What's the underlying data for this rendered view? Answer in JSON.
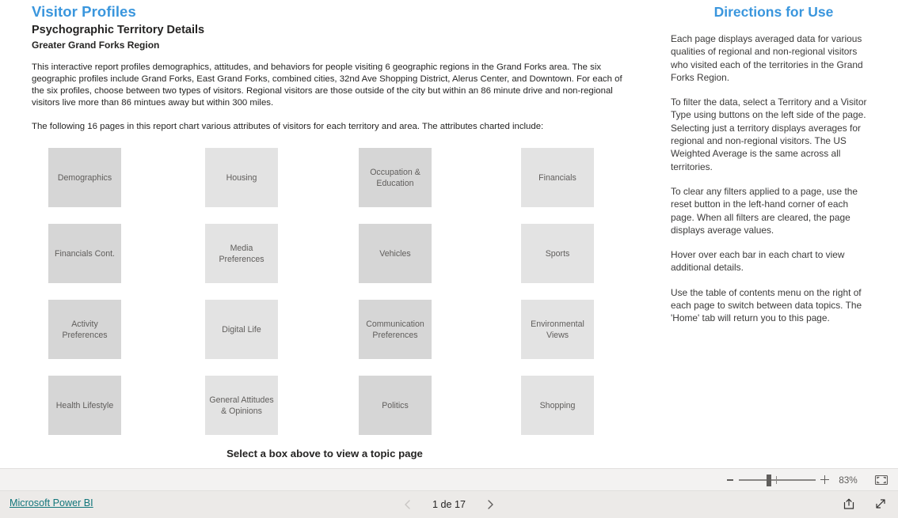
{
  "report": {
    "title": "Visitor Profiles",
    "subtitle": "Psychographic Territory Details",
    "region": "Greater Grand Forks Region",
    "intro_paragraph_1": "This interactive report profiles demographics, attitudes, and behaviors for people visiting 6 geographic regions in the Grand Forks area. The six geographic profiles include Grand Forks, East Grand Forks, combined cities, 32nd Ave Shopping District, Alerus Center, and Downtown. For each of the six profiles, choose between two types of visitors. Regional visitors are those outside of the city but within an 86 minute drive and non-regional visitors live more than 86 mintues away but within 300 miles.",
    "intro_paragraph_2": "The following 16 pages in this report chart various attributes of visitors for each territory and area. The attributes charted include:",
    "select_hint": "Select a box above to view a topic page",
    "accent_color": "#3a96dd",
    "text_color": "#252423"
  },
  "topics": {
    "rows": [
      [
        {
          "label": "Demographics",
          "shade": "shade-a"
        },
        {
          "label": "Housing",
          "shade": "shade-b"
        },
        {
          "label": "Occupation &\nEducation",
          "shade": "shade-a"
        },
        {
          "label": "Financials",
          "shade": "shade-b"
        }
      ],
      [
        {
          "label": "Financials Cont.",
          "shade": "shade-a"
        },
        {
          "label": "Media\nPreferences",
          "shade": "shade-b"
        },
        {
          "label": "Vehicles",
          "shade": "shade-a"
        },
        {
          "label": "Sports",
          "shade": "shade-b"
        }
      ],
      [
        {
          "label": "Activity\nPreferences",
          "shade": "shade-a"
        },
        {
          "label": "Digital Life",
          "shade": "shade-b"
        },
        {
          "label": "Communication\nPreferences",
          "shade": "shade-a"
        },
        {
          "label": "Environmental\nViews",
          "shade": "shade-b"
        }
      ],
      [
        {
          "label": "Health Lifestyle",
          "shade": "shade-a"
        },
        {
          "label": "General Attitudes\n& Opinions",
          "shade": "shade-b"
        },
        {
          "label": "Politics",
          "shade": "shade-a"
        },
        {
          "label": "Shopping",
          "shade": "shade-b"
        }
      ]
    ]
  },
  "directions": {
    "title": "Directions for Use",
    "paragraphs": [
      "Each page displays averaged data for various qualities of regional and non-regional visitors who visited each of the territories in the Grand Forks Region.",
      "To filter the data,  select a Territory and a Visitor Type using buttons on the left side of the page. Selecting just a territory displays averages for regional and non-regional visitors.  The US Weighted Average is the same across all territories.",
      "To clear any filters applied to a page, use the reset button in the left-hand corner of each page. When all filters are cleared, the page displays average values.",
      "Hover over each bar in each chart to view additional details.",
      "Use the table of contents menu on the right of each page to switch between data topics. The 'Home' tab will return you to this page."
    ]
  },
  "statusbar": {
    "zoom_percent": "83%",
    "zoom_out_icon": "minus-icon",
    "zoom_in_icon": "plus-icon",
    "fit_to_page_icon": "fit-to-page-icon"
  },
  "footer": {
    "brand_link": "Microsoft Power BI",
    "brand_link_color": "#11757a",
    "page_indicator": "1 de 17",
    "prev_icon": "chevron-left-icon",
    "next_icon": "chevron-right-icon",
    "share_icon": "share-icon",
    "fullscreen_icon": "fullscreen-icon"
  }
}
